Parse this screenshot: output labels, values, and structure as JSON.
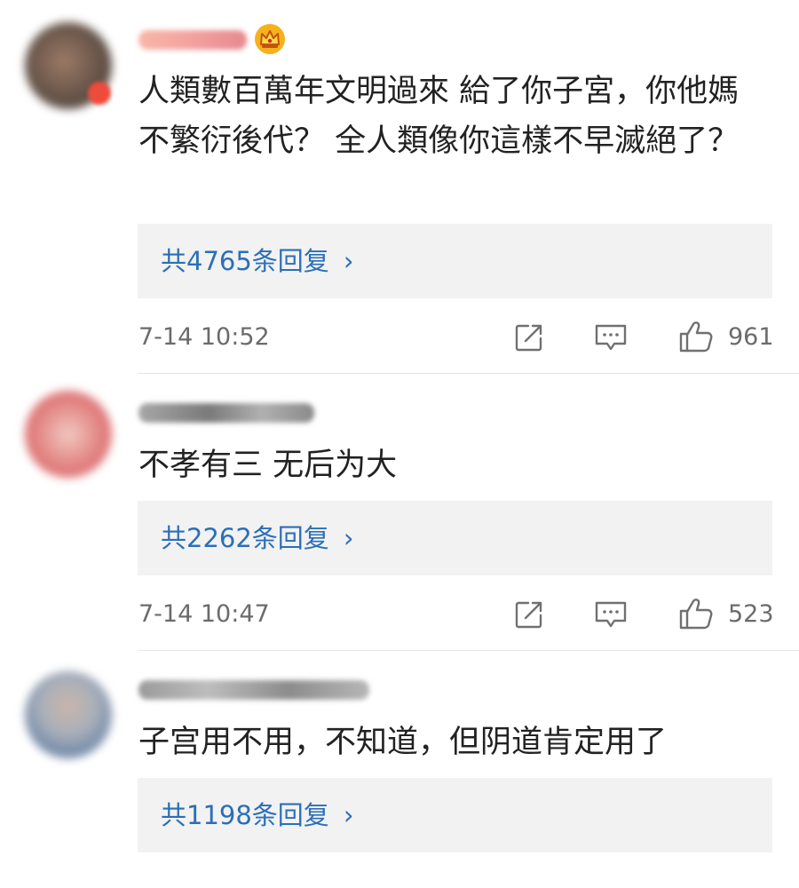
{
  "comments": [
    {
      "text": "人類數百萬年文明過來 給了你子宮，你他媽不繁衍後代？ 全人類像你這樣不早滅絕了？",
      "reply_link": "共4765条回复",
      "timestamp": "7-14 10:52",
      "likes": "961"
    },
    {
      "text": "不孝有三 无后为大",
      "reply_link": "共2262条回复",
      "timestamp": "7-14 10:47",
      "likes": "523"
    },
    {
      "text": "子宫用不用，不知道，但阴道肯定用了",
      "reply_link": "共1198条回复"
    }
  ],
  "reply_chevron": "›",
  "icons": {
    "share": "share-icon",
    "comment": "comment-icon",
    "like": "thumbs-up-icon",
    "crown": "crown-badge-icon"
  },
  "colors": {
    "link": "#2b6fb8",
    "meta": "#6b6b6b",
    "reply_bg": "#f2f2f2",
    "text": "#222222"
  }
}
